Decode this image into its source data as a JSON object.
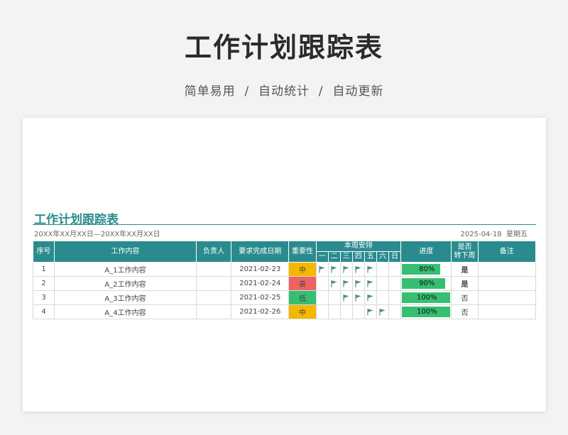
{
  "hero": {
    "title": "工作计划跟踪表",
    "subtitle": "简单易用  /  自动统计  /  自动更新"
  },
  "sheet": {
    "title": "工作计划跟踪表",
    "date_range": "20XX年XX月XX日—20XX年XX月XX日",
    "today": "2025-04-18  星期五"
  },
  "table": {
    "headers": {
      "index": "序号",
      "content": "工作内容",
      "owner": "负责人",
      "due": "要求完成日期",
      "importance": "重要性",
      "week_group": "本周安排",
      "progress": "进度",
      "carry": "是否\n转下周",
      "notes": "备注"
    },
    "weekdays": [
      "一",
      "二",
      "三",
      "四",
      "五",
      "六",
      "日"
    ],
    "rows": [
      {
        "index": "1",
        "content": "A_1工作内容",
        "owner": "",
        "due": "2021-02-23",
        "importance": "中",
        "imp_level": "mid",
        "days": [
          true,
          true,
          true,
          true,
          true,
          false,
          false
        ],
        "progress_label": "80%",
        "progress_value": 0.8,
        "carry": "是",
        "carry_flag": true,
        "notes": ""
      },
      {
        "index": "2",
        "content": "A_2工作内容",
        "owner": "",
        "due": "2021-02-24",
        "importance": "高",
        "imp_level": "high",
        "days": [
          false,
          true,
          true,
          true,
          true,
          false,
          false
        ],
        "progress_label": "90%",
        "progress_value": 0.9,
        "carry": "是",
        "carry_flag": true,
        "notes": ""
      },
      {
        "index": "3",
        "content": "A_3工作内容",
        "owner": "",
        "due": "2021-02-25",
        "importance": "低",
        "imp_level": "low",
        "days": [
          false,
          false,
          true,
          true,
          true,
          false,
          false
        ],
        "progress_label": "100%",
        "progress_value": 1.0,
        "carry": "否",
        "carry_flag": false,
        "notes": ""
      },
      {
        "index": "4",
        "content": "A_4工作内容",
        "owner": "",
        "due": "2021-02-26",
        "importance": "中",
        "imp_level": "mid",
        "days": [
          false,
          false,
          false,
          false,
          true,
          true,
          false
        ],
        "progress_label": "100%",
        "progress_value": 1.0,
        "carry": "否",
        "carry_flag": false,
        "notes": ""
      }
    ]
  },
  "icons": {
    "scheduled": "flag-icon"
  },
  "colors": {
    "accent": "#2a8b8e",
    "importance_mid": "#f5b800",
    "importance_high": "#f06262",
    "importance_low": "#36bf72",
    "progress": "#36bf72",
    "flag": "#4f8f7a",
    "carry_yes": "#e23b3b"
  }
}
